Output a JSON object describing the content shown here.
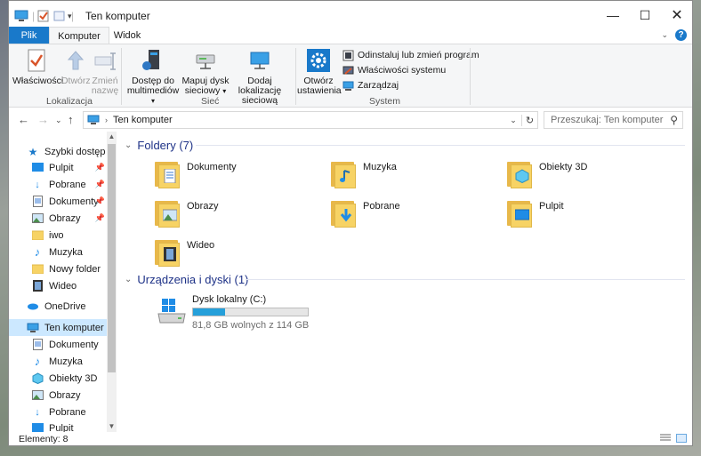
{
  "window": {
    "title": "Ten komputer"
  },
  "ribbon_tabs": {
    "file": "Plik",
    "computer": "Komputer",
    "view": "Widok"
  },
  "ribbon": {
    "location": {
      "label": "Lokalizacja",
      "properties": "Właściwości",
      "open": "Otwórz",
      "rename_l1": "Zmień",
      "rename_l2": "nazwę"
    },
    "network": {
      "label": "Sieć",
      "media_l1": "Dostęp do",
      "media_l2": "multimediów",
      "map_l1": "Mapuj dysk",
      "map_l2": "sieciowy",
      "add_l1": "Dodaj lokalizację",
      "add_l2": "sieciową"
    },
    "system": {
      "label": "System",
      "settings_l1": "Otwórz",
      "settings_l2": "ustawienia",
      "uninstall": "Odinstaluj lub zmień program",
      "sys_props": "Właściwości systemu",
      "manage": "Zarządzaj"
    }
  },
  "address_bar": {
    "path": "Ten komputer",
    "search_placeholder": "Przeszukaj: Ten komputer"
  },
  "sidebar": {
    "quick_access": "Szybki dostęp",
    "quick_items": [
      {
        "label": "Pulpit",
        "pinned": true
      },
      {
        "label": "Pobrane",
        "pinned": true
      },
      {
        "label": "Dokumenty",
        "pinned": true
      },
      {
        "label": "Obrazy",
        "pinned": true
      },
      {
        "label": "iwo",
        "pinned": false
      },
      {
        "label": "Muzyka",
        "pinned": false
      },
      {
        "label": "Nowy folder",
        "pinned": false
      },
      {
        "label": "Wideo",
        "pinned": false
      }
    ],
    "onedrive": "OneDrive",
    "this_pc": "Ten komputer",
    "pc_items": [
      "Dokumenty",
      "Muzyka",
      "Obiekty 3D",
      "Obrazy",
      "Pobrane",
      "Pulpit"
    ]
  },
  "content": {
    "folders_header": "Foldery (7)",
    "folders": [
      "Dokumenty",
      "Muzyka",
      "Obiekty 3D",
      "Obrazy",
      "Pobrane",
      "Pulpit",
      "Wideo"
    ],
    "drives_header": "Urządzenia i dyski (1)",
    "drive": {
      "name": "Dysk lokalny (C:)",
      "free_text": "81,8 GB wolnych z 114 GB",
      "used_fraction": 0.28
    }
  },
  "status": {
    "items": "Elementy: 8"
  },
  "colors": {
    "accent": "#1979ca",
    "selection": "#cce8ff",
    "header_text": "#1e3287",
    "drive_bar": "#26a0da"
  }
}
